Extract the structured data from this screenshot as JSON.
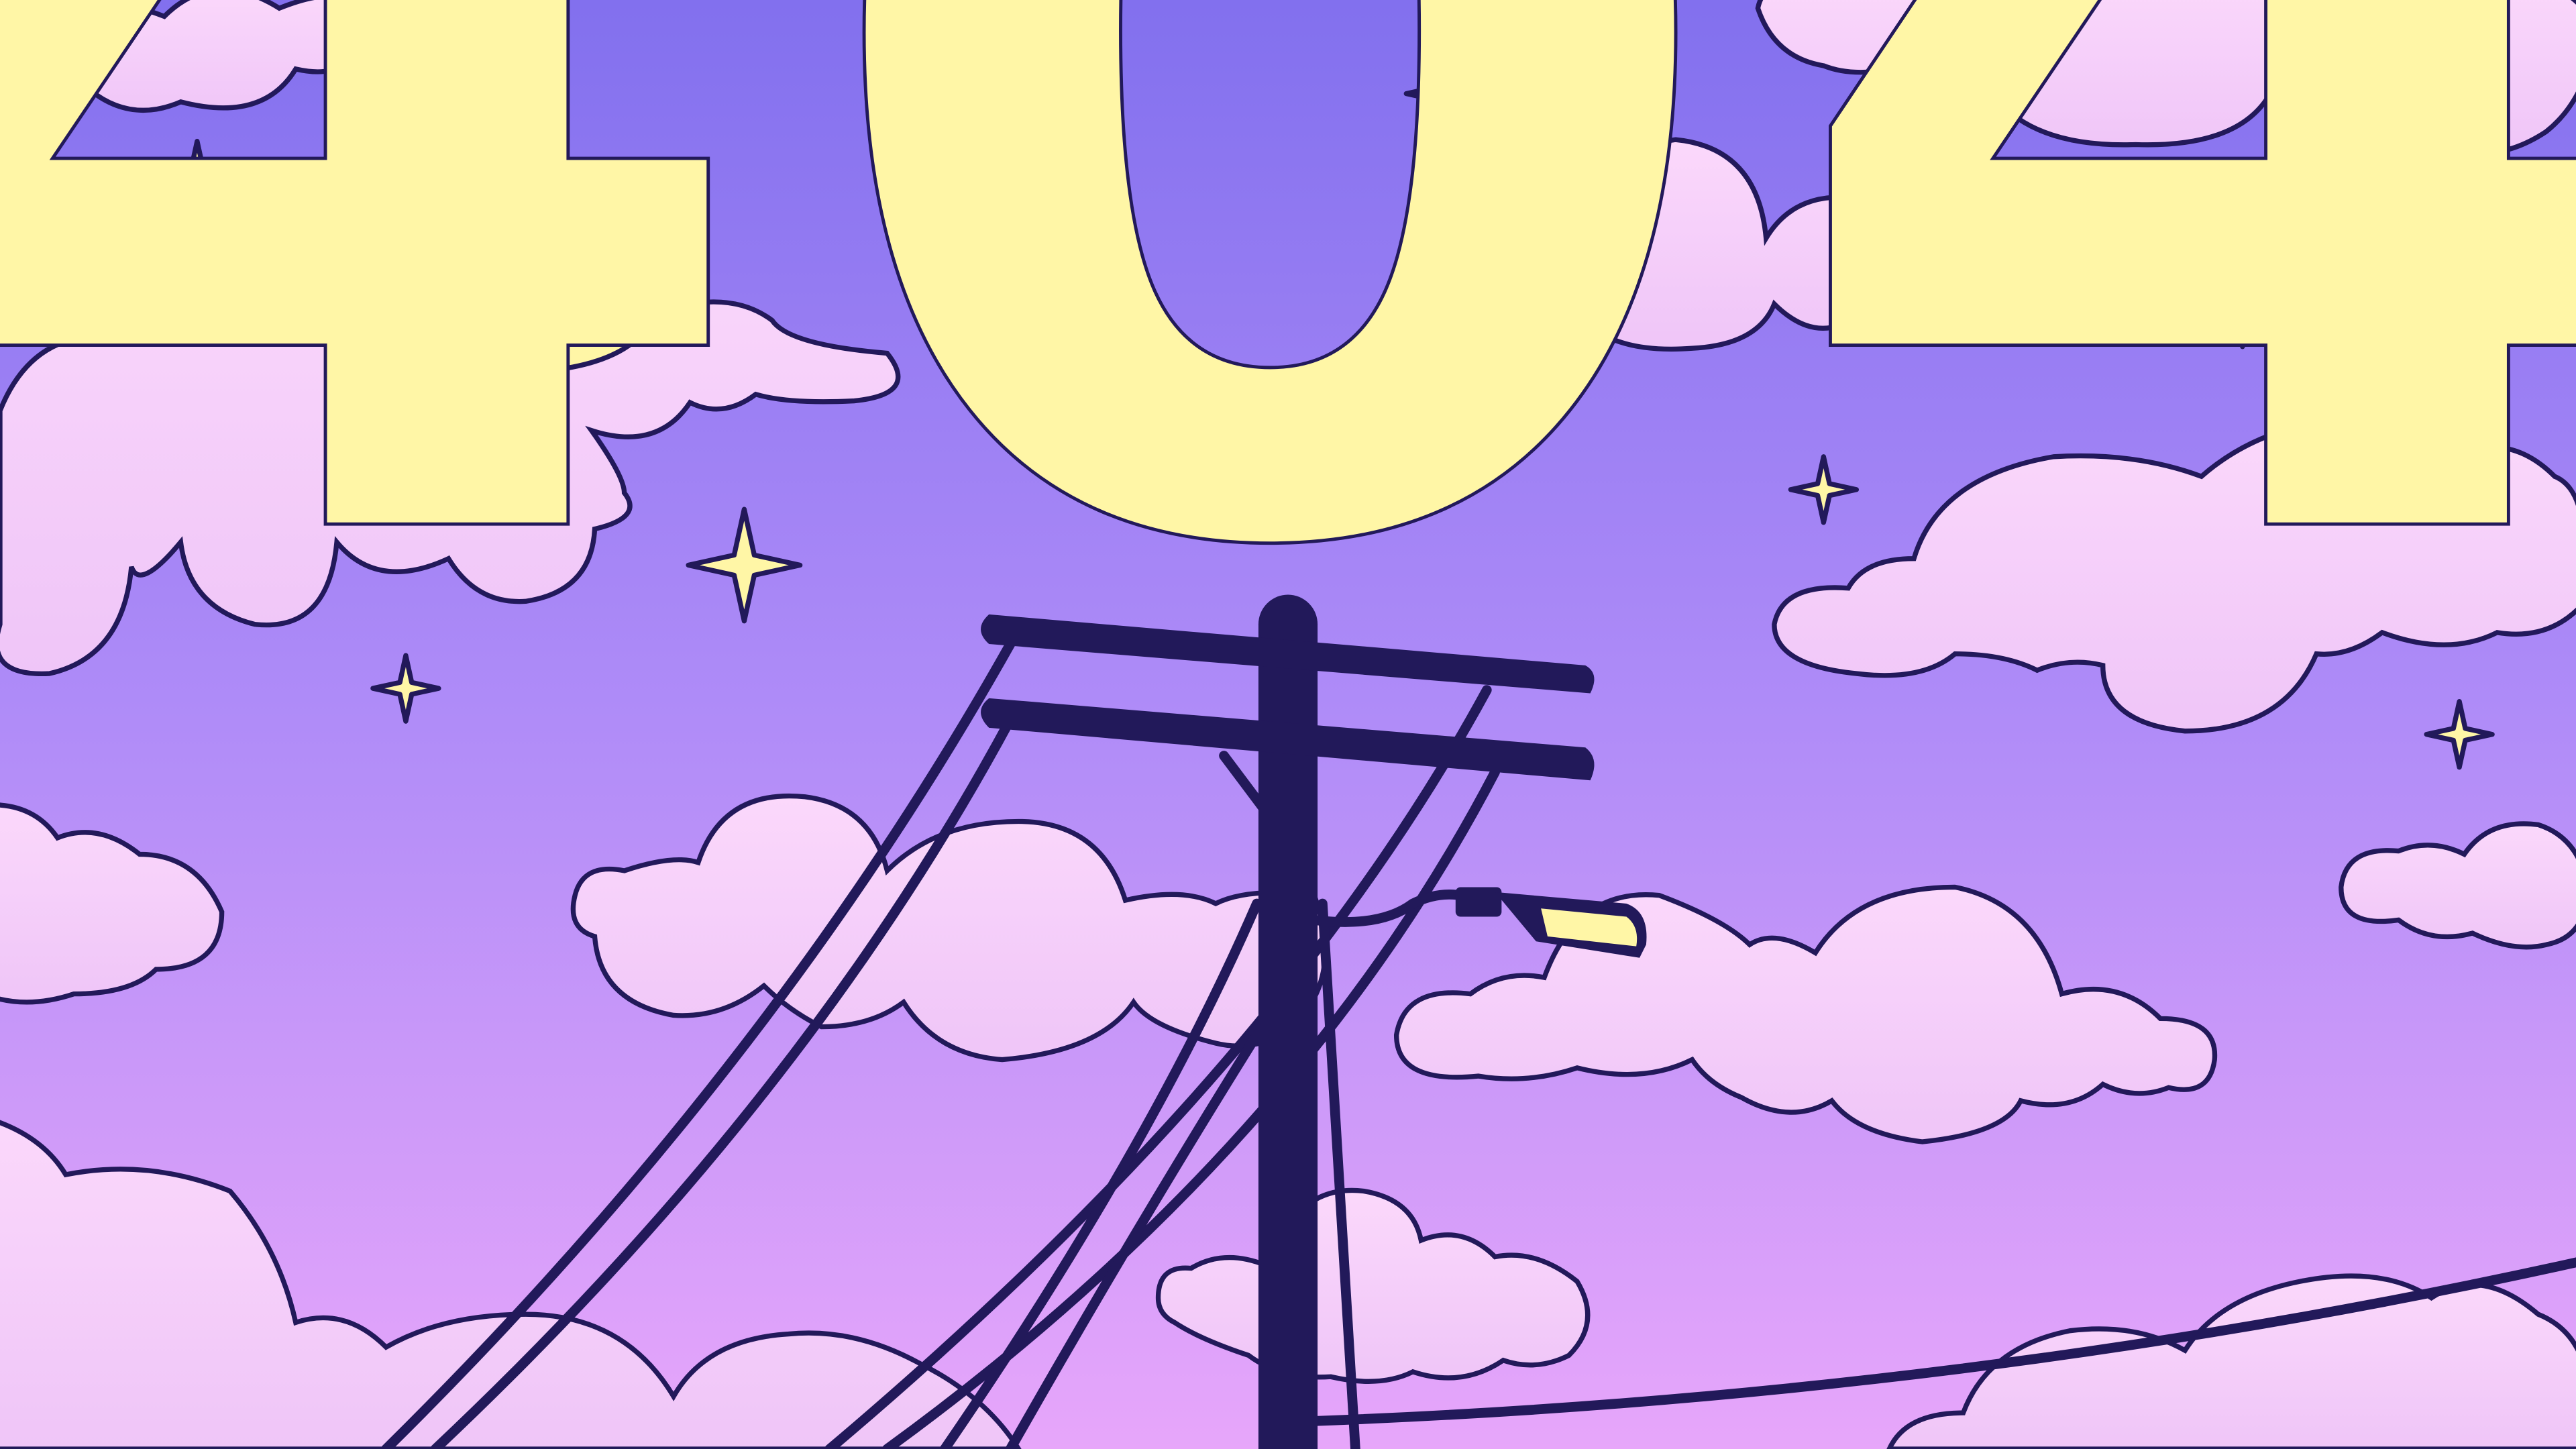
{
  "error": {
    "code": "404"
  },
  "colors": {
    "sky_top": "#8270ee",
    "sky_mid": "#b08cf8",
    "sky_bottom": "#e7a6fa",
    "cloud_light": "#fbd8fb",
    "cloud_dark": "#efc5f8",
    "outline": "#22195a",
    "accent_yellow": "#fff6a6"
  },
  "scene": {
    "subject": "night-sky-with-utility-pole",
    "icons": [
      "crescent-moon-icon",
      "sparkle-star-icon",
      "street-lamp-icon",
      "cloud-icon"
    ]
  }
}
